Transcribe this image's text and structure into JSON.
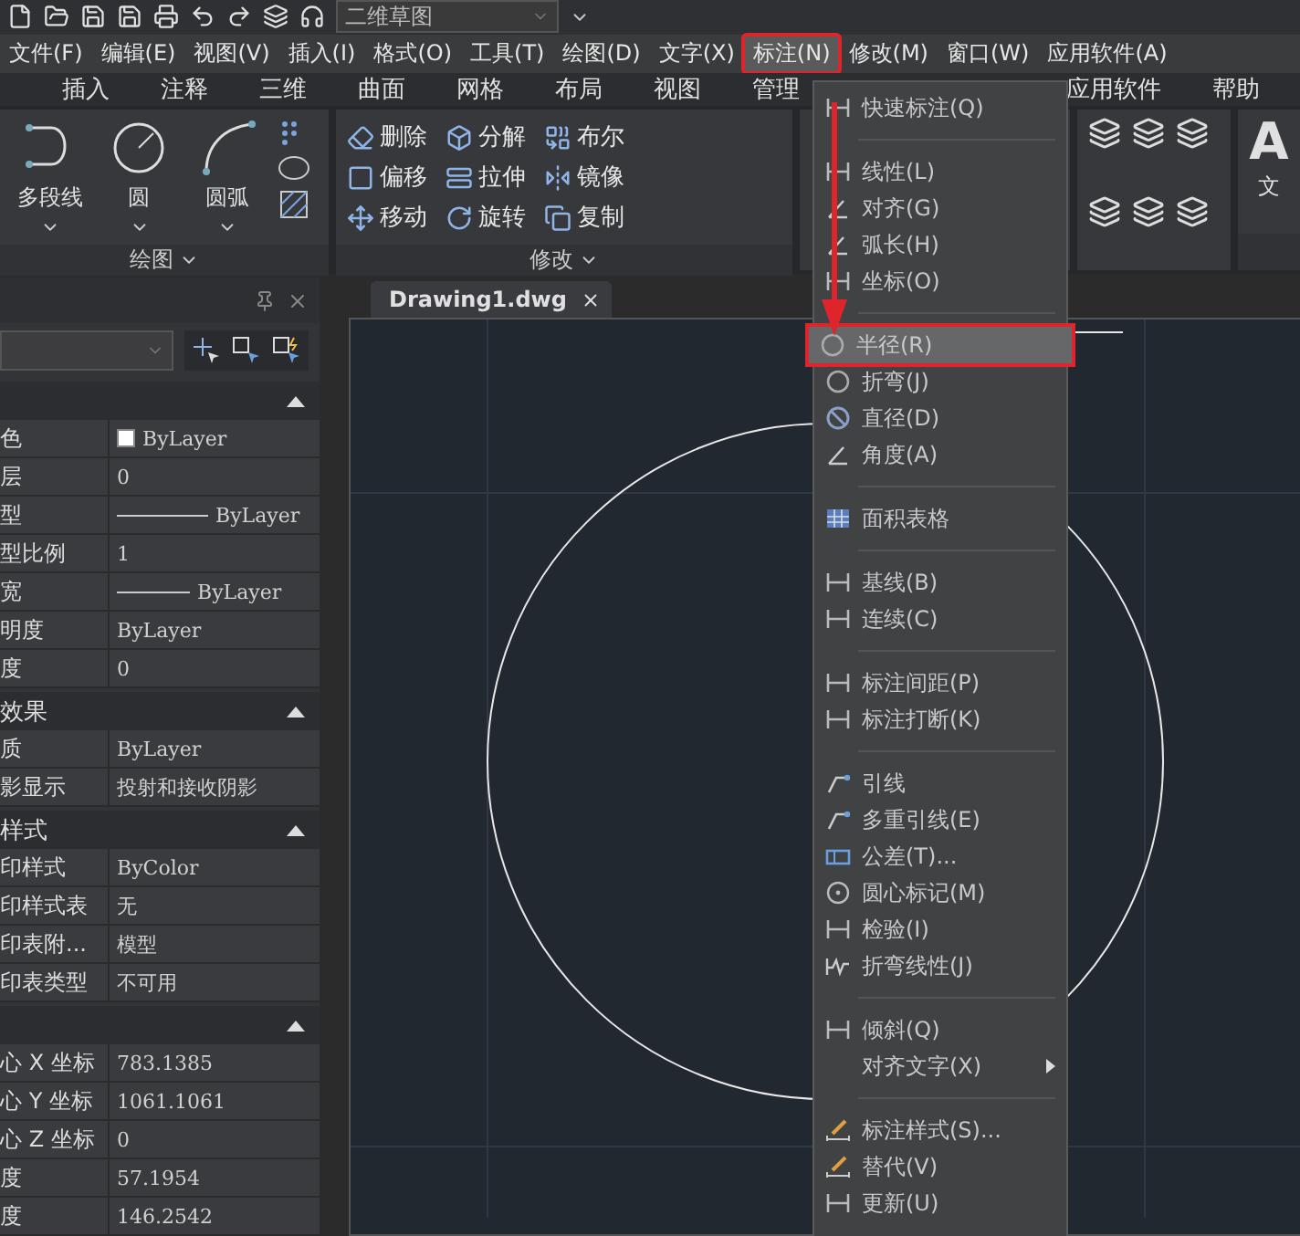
{
  "quick_access": {
    "workspace": "二维草图"
  },
  "menu_bar": [
    {
      "label": "文件(F)",
      "selected": false
    },
    {
      "label": "编辑(E)",
      "selected": false
    },
    {
      "label": "视图(V)",
      "selected": false
    },
    {
      "label": "插入(I)",
      "selected": false
    },
    {
      "label": "格式(O)",
      "selected": false
    },
    {
      "label": "工具(T)",
      "selected": false
    },
    {
      "label": "绘图(D)",
      "selected": false
    },
    {
      "label": "文字(X)",
      "selected": false
    },
    {
      "label": "标注(N)",
      "selected": true
    },
    {
      "label": "修改(M)",
      "selected": false
    },
    {
      "label": "窗口(W)",
      "selected": false
    },
    {
      "label": "应用软件(A)",
      "selected": false
    }
  ],
  "ribbon_tabs": [
    "插入",
    "注释",
    "三维",
    "曲面",
    "网格",
    "布局",
    "视图",
    "管理"
  ],
  "ribbon_tabs_right": [
    "应用软件",
    "帮助"
  ],
  "ribbon": {
    "draw_group": {
      "title": "绘图",
      "tools": [
        "多段线",
        "圆",
        "圆弧"
      ]
    },
    "modify_group": {
      "title": "修改",
      "tools": [
        "删除",
        "分解",
        "布尔",
        "偏移",
        "拉伸",
        "镜像",
        "移动",
        "旋转",
        "复制"
      ]
    },
    "text_group": {
      "letter": "A",
      "tool": "文"
    }
  },
  "properties": {
    "sections": [
      {
        "rows": [
          {
            "label": "色",
            "value": "ByLayer",
            "kind": "swatch"
          },
          {
            "label": "层",
            "value": "0",
            "kind": "text"
          },
          {
            "label": "型",
            "value": "ByLayer",
            "kind": "line"
          },
          {
            "label": "型比例",
            "value": "1",
            "kind": "text"
          },
          {
            "label": "宽",
            "value": "ByLayer",
            "kind": "line"
          },
          {
            "label": "明度",
            "value": "ByLayer",
            "kind": "text"
          },
          {
            "label": "度",
            "value": "0",
            "kind": "text"
          }
        ]
      },
      {
        "title": "效果",
        "rows": [
          {
            "label": "质",
            "value": "ByLayer",
            "kind": "text"
          },
          {
            "label": "影显示",
            "value": "投射和接收阴影",
            "kind": "text"
          }
        ]
      },
      {
        "title": "样式",
        "rows": [
          {
            "label": "印样式",
            "value": "ByColor",
            "kind": "text"
          },
          {
            "label": "印样式表",
            "value": "无",
            "kind": "text"
          },
          {
            "label": "印表附...",
            "value": "模型",
            "kind": "text"
          },
          {
            "label": "印表类型",
            "value": "不可用",
            "kind": "text"
          }
        ]
      },
      {
        "rows": [
          {
            "label": "心 X 坐标",
            "value": "783.1385",
            "kind": "text"
          },
          {
            "label": "心 Y 坐标",
            "value": "1061.1061",
            "kind": "text"
          },
          {
            "label": "心 Z 坐标",
            "value": "0",
            "kind": "text"
          },
          {
            "label": "度",
            "value": "57.1954",
            "kind": "text"
          },
          {
            "label": "度",
            "value": "146.2542",
            "kind": "text"
          }
        ]
      }
    ]
  },
  "document_tab": "Drawing1.dwg",
  "dimension_menu": {
    "groups": [
      [
        {
          "label": "快速标注(Q)",
          "selected": false,
          "submenu": false
        }
      ],
      [
        {
          "label": "线性(L)",
          "selected": false,
          "submenu": false
        },
        {
          "label": "对齐(G)",
          "selected": false,
          "submenu": false
        },
        {
          "label": "弧长(H)",
          "selected": false,
          "submenu": false
        },
        {
          "label": "坐标(O)",
          "selected": false,
          "submenu": false
        }
      ],
      [
        {
          "label": "半径(R)",
          "selected": true,
          "submenu": false
        },
        {
          "label": "折弯(J)",
          "selected": false,
          "submenu": false
        },
        {
          "label": "直径(D)",
          "selected": false,
          "submenu": false
        },
        {
          "label": "角度(A)",
          "selected": false,
          "submenu": false
        }
      ],
      [
        {
          "label": "面积表格",
          "selected": false,
          "submenu": false
        }
      ],
      [
        {
          "label": "基线(B)",
          "selected": false,
          "submenu": false
        },
        {
          "label": "连续(C)",
          "selected": false,
          "submenu": false
        }
      ],
      [
        {
          "label": "标注间距(P)",
          "selected": false,
          "submenu": false
        },
        {
          "label": "标注打断(K)",
          "selected": false,
          "submenu": false
        }
      ],
      [
        {
          "label": "引线",
          "selected": false,
          "submenu": false
        },
        {
          "label": "多重引线(E)",
          "selected": false,
          "submenu": false
        },
        {
          "label": "公差(T)...",
          "selected": false,
          "submenu": false
        },
        {
          "label": "圆心标记(M)",
          "selected": false,
          "submenu": false
        },
        {
          "label": "检验(I)",
          "selected": false,
          "submenu": false
        },
        {
          "label": "折弯线性(J)",
          "selected": false,
          "submenu": false
        }
      ],
      [
        {
          "label": "倾斜(Q)",
          "selected": false,
          "submenu": false
        },
        {
          "label": "对齐文字(X)",
          "selected": false,
          "submenu": true
        }
      ],
      [
        {
          "label": "标注样式(S)...",
          "selected": false,
          "submenu": false
        },
        {
          "label": "替代(V)",
          "selected": false,
          "submenu": false
        },
        {
          "label": "更新(U)",
          "selected": false,
          "submenu": false
        }
      ]
    ]
  }
}
